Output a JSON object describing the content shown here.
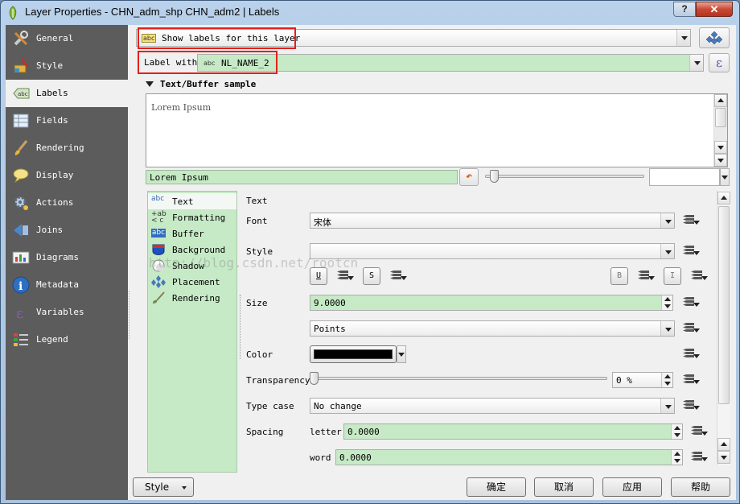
{
  "window": {
    "title": "Layer Properties - CHN_adm_shp CHN_adm2 | Labels",
    "help_label": "?",
    "close_label": "✕"
  },
  "sidebar": {
    "items": [
      {
        "label": "General",
        "icon": "wrench-icon"
      },
      {
        "label": "Style",
        "icon": "paintbrush-icon"
      },
      {
        "label": "Labels",
        "icon": "abc-label-icon"
      },
      {
        "label": "Fields",
        "icon": "table-icon"
      },
      {
        "label": "Rendering",
        "icon": "brush-icon"
      },
      {
        "label": "Display",
        "icon": "speech-bubble-icon"
      },
      {
        "label": "Actions",
        "icon": "gear-icon"
      },
      {
        "label": "Joins",
        "icon": "joins-icon"
      },
      {
        "label": "Diagrams",
        "icon": "diagram-icon"
      },
      {
        "label": "Metadata",
        "icon": "info-icon"
      },
      {
        "label": "Variables",
        "icon": "epsilon-icon"
      },
      {
        "label": "Legend",
        "icon": "legend-icon"
      }
    ],
    "active": "Labels"
  },
  "labeling": {
    "mode": "Show labels for this layer",
    "label_with_caption": "Label with",
    "label_field": "NL_NAME_2",
    "abc_badge": "abc",
    "expression_button": "ε"
  },
  "sample": {
    "section_title": "Text/Buffer sample",
    "preview_text": "Lorem Ipsum",
    "sample_field_value": "Lorem Ipsum",
    "reset_glyph": "↶"
  },
  "tabs": [
    {
      "label": "Text",
      "icon_text": "abc"
    },
    {
      "label": "Formatting",
      "icon_text": "+ab\n< c"
    },
    {
      "label": "Buffer",
      "icon_text": "abc"
    },
    {
      "label": "Background",
      "icon_text": ""
    },
    {
      "label": "Shadow",
      "icon_text": ""
    },
    {
      "label": "Placement",
      "icon_text": ""
    },
    {
      "label": "Rendering",
      "icon_text": ""
    }
  ],
  "text_panel": {
    "heading": "Text",
    "font_label": "Font",
    "font_value": "宋体",
    "style_label": "Style",
    "style_value": "",
    "underline_btn": "U",
    "strike_btn": "S",
    "bold_btn": "B",
    "italic_btn": "I",
    "size_label": "Size",
    "size_value": "9.0000",
    "size_unit": "Points",
    "color_label": "Color",
    "color_value": "#000000",
    "transparency_label": "Transparency",
    "transparency_value": "0 %",
    "transparency_level": 0,
    "type_case_label": "Type case",
    "type_case_value": "No change",
    "spacing_label": "Spacing",
    "letter_label": "letter",
    "letter_value": "0.0000",
    "word_label": "word",
    "word_value": "0.0000"
  },
  "watermark": "http://blog.csdn.net/rootcn",
  "footer": {
    "style_button": "Style",
    "ok": "确定",
    "cancel": "取消",
    "apply": "应用",
    "help": "帮助"
  },
  "colors": {
    "highlight_border": "#e0211c",
    "field_green": "#c6eac6",
    "sidebar_bg": "#5c5c5c"
  }
}
